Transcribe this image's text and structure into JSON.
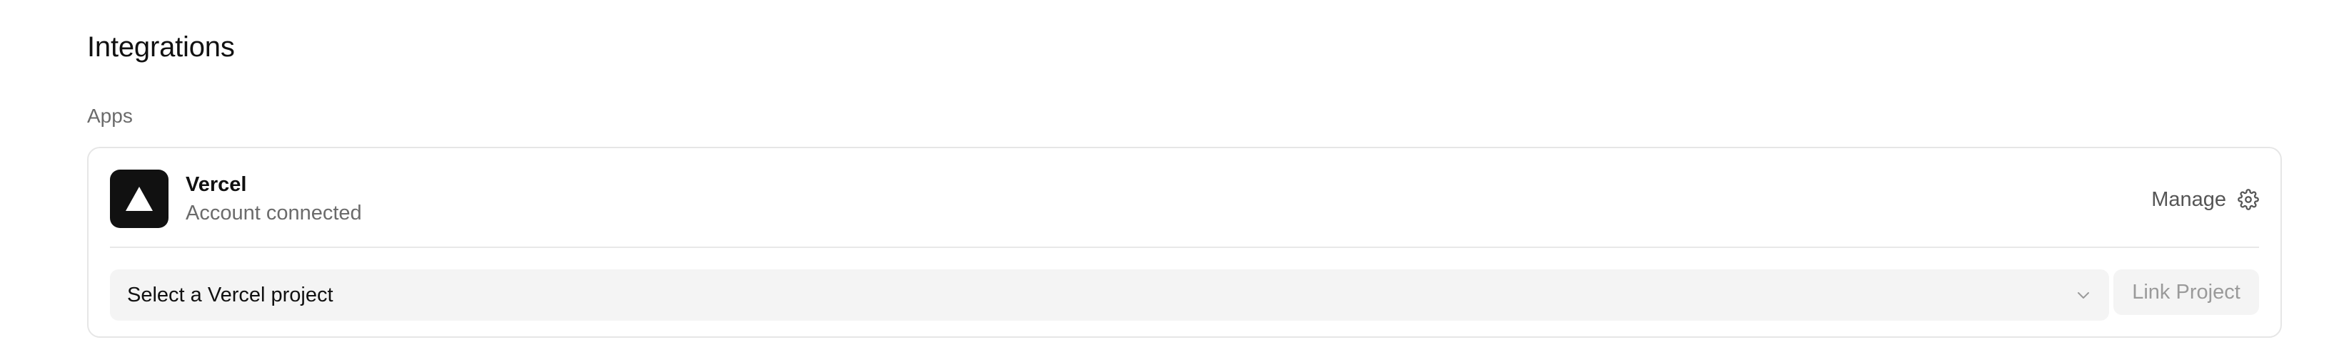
{
  "page": {
    "title": "Integrations"
  },
  "apps_section": {
    "label": "Apps",
    "app": {
      "name": "Vercel",
      "status": "Account connected",
      "logo_icon": "vercel-triangle-icon",
      "manage_label": "Manage",
      "manage_icon": "gear-icon"
    },
    "project_select": {
      "value": "Select a Vercel project",
      "icon": "chevron-down-icon"
    },
    "link_button": {
      "label": "Link Project",
      "disabled": true
    }
  }
}
